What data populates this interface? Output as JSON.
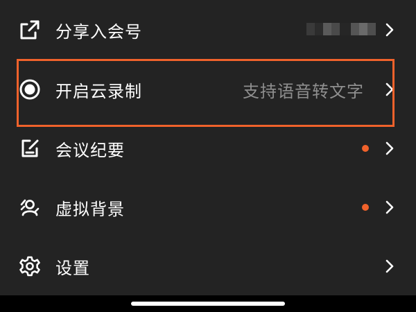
{
  "menu": {
    "items": [
      {
        "label": "分享入会号",
        "icon": "share-icon",
        "sub": "",
        "dot": false,
        "redacted": true
      },
      {
        "label": "开启云录制",
        "icon": "record-icon",
        "sub": "支持语音转文字",
        "dot": false,
        "redacted": false,
        "highlighted": true
      },
      {
        "label": "会议纪要",
        "icon": "notes-edit-icon",
        "sub": "",
        "dot": true,
        "redacted": false
      },
      {
        "label": "虚拟背景",
        "icon": "virtual-background-icon",
        "sub": "",
        "dot": true,
        "redacted": false
      },
      {
        "label": "设置",
        "icon": "gear-icon",
        "sub": "",
        "dot": false,
        "redacted": false
      }
    ]
  },
  "colors": {
    "background": "#232323",
    "text": "#ffffff",
    "secondary_text": "#8f8f8f",
    "accent": "#f0622b",
    "bottom_bar": "#000000"
  }
}
